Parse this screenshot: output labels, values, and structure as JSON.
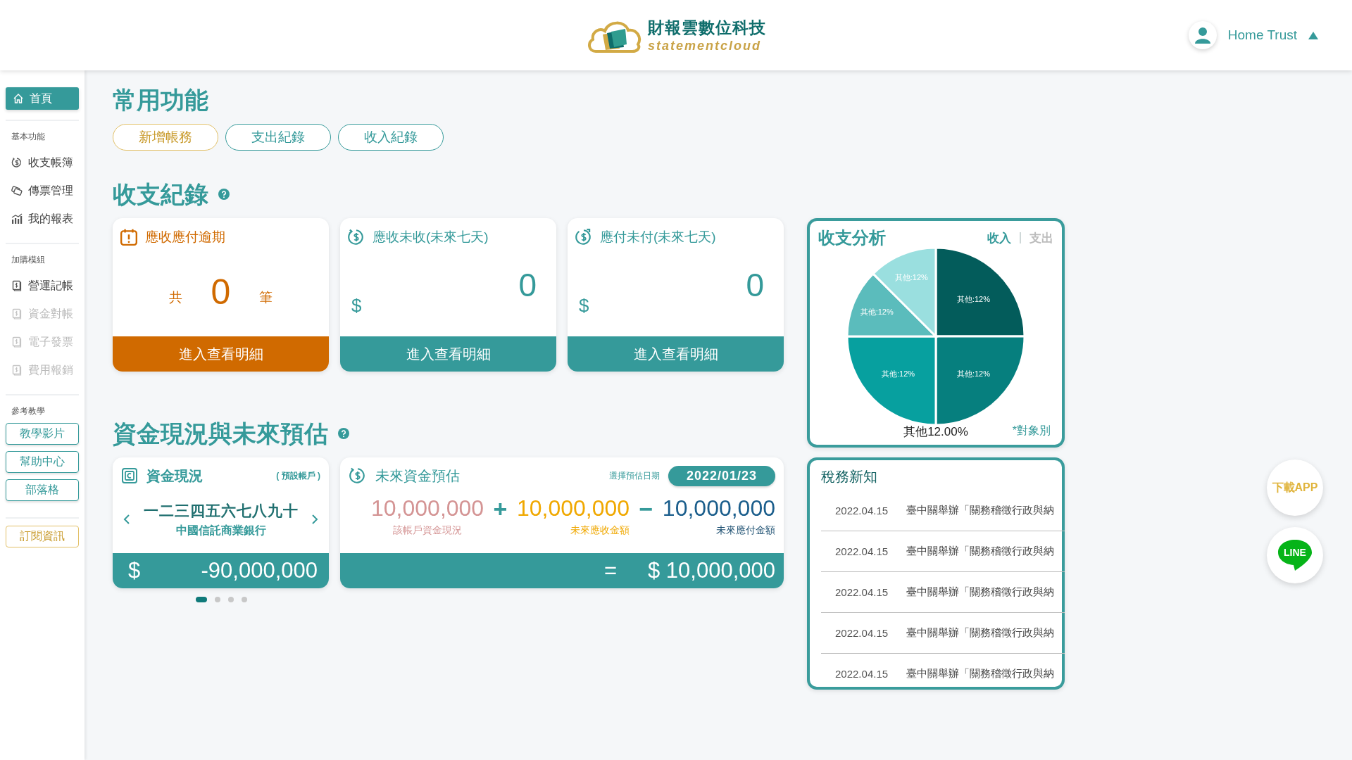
{
  "header": {
    "logo_title": "財報雲數位科技",
    "logo_subtitle": "statementcloud",
    "user": "Home Trust"
  },
  "sidebar": {
    "home": {
      "label": "首頁",
      "selected": true
    },
    "sections": [
      {
        "title": "基本功能",
        "items": [
          {
            "label": "收支帳簿",
            "kind": "cycle",
            "disabled": false
          },
          {
            "label": "傳票管理",
            "kind": "ticket",
            "disabled": false
          },
          {
            "label": "我的報表",
            "kind": "chart",
            "disabled": false
          }
        ]
      },
      {
        "title": "加購模組",
        "items": [
          {
            "label": "營運記帳",
            "kind": "ledger",
            "disabled": false
          },
          {
            "label": "資金對帳",
            "kind": "ledger",
            "disabled": true
          },
          {
            "label": "電子發票",
            "kind": "ledger",
            "disabled": true
          },
          {
            "label": "費用報銷",
            "kind": "ledger",
            "disabled": true
          }
        ]
      }
    ],
    "reference": {
      "title": "參考教學",
      "links": [
        "教學影片",
        "幫助中心",
        "部落格"
      ]
    },
    "subscribe": "訂閱資訊"
  },
  "quick_functions": {
    "title": "常用功能",
    "buttons": [
      {
        "label": "新增帳務",
        "selected": true
      },
      {
        "label": "支出紀錄",
        "selected": false
      },
      {
        "label": "收入紀錄",
        "selected": false
      }
    ]
  },
  "records": {
    "title": "收支紀錄",
    "cards": [
      {
        "kind": "count",
        "title": "應收應付逾期",
        "prefix": "共",
        "value": "0",
        "suffix": "筆",
        "button": "進入查看明細"
      },
      {
        "kind": "receivable",
        "title": "應收未收(未來七天)",
        "currency": "$",
        "value": "0",
        "button": "進入查看明細"
      },
      {
        "kind": "payable",
        "title": "應付未付(未來七天)",
        "currency": "$",
        "value": "0",
        "button": "進入查看明細"
      }
    ]
  },
  "analysis": {
    "title": "收支分析",
    "toggles": [
      {
        "label": "收入",
        "selected": true
      },
      {
        "label": "支出",
        "selected": false
      }
    ],
    "slices": [
      {
        "kind": "quarter",
        "label": "其他:12%",
        "color": "#035c5b"
      },
      {
        "kind": "quarter",
        "label": "其他:12%",
        "color": "#067f7e"
      },
      {
        "kind": "quarter",
        "label": "其他:12%",
        "color": "#07a09f"
      },
      {
        "kind": "eighth",
        "label": "其他:12%",
        "color": "#5bbcbc"
      },
      {
        "kind": "eighth",
        "label": "其他:12%",
        "color": "#9adfdf"
      }
    ],
    "caption": "其他12.00%",
    "footnote": "*對象別"
  },
  "funds": {
    "title": "資金現況與未來預估",
    "status": {
      "title": "資金現況",
      "note": "( 預設帳戶 )",
      "account": "一二三四五六七八九十",
      "bank": "中國信託商業銀行",
      "currency": "$",
      "amount": "-90,000,000"
    },
    "pager": [
      {
        "selected": true
      },
      {
        "selected": false
      },
      {
        "selected": false
      },
      {
        "selected": false
      }
    ],
    "forecast": {
      "title": "未來資金預估",
      "date_label": "選擇預估日期",
      "date": "2022/01/23",
      "terms": [
        {
          "kind": "current",
          "value": "10,000,000",
          "label": "該帳戶資金現況"
        },
        {
          "kind": "operator",
          "value": "+"
        },
        {
          "kind": "receivable",
          "value": "10,000,000",
          "label": "未來應收金額"
        },
        {
          "kind": "operator",
          "value": "−"
        },
        {
          "kind": "payable",
          "value": "10,000,000",
          "label": "未來應付金額"
        }
      ],
      "equals": "=",
      "result": "$ 10,000,000"
    }
  },
  "news": {
    "title": "稅務新知",
    "items": [
      {
        "date": "2022.04.15",
        "text": "臺中關舉辦「關務稽徵行政與納"
      },
      {
        "date": "2022.04.15",
        "text": "臺中關舉辦「關務稽徵行政與納"
      },
      {
        "date": "2022.04.15",
        "text": "臺中關舉辦「關務稽徵行政與納"
      },
      {
        "date": "2022.04.15",
        "text": "臺中關舉辦「關務稽徵行政與納"
      },
      {
        "date": "2022.04.15",
        "text": "臺中關舉辦「關務稽徵行政與納"
      }
    ]
  },
  "floating": {
    "download": "下載APP",
    "line": "LINE"
  }
}
